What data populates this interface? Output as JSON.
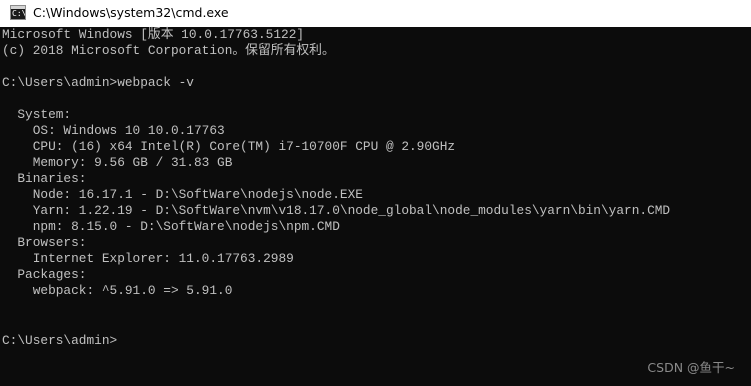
{
  "window": {
    "title": "C:\\Windows\\system32\\cmd.exe",
    "icon": "cmd-icon"
  },
  "console": {
    "lines": [
      "Microsoft Windows [版本 10.0.17763.5122]",
      "(c) 2018 Microsoft Corporation。保留所有权利。",
      "",
      "C:\\Users\\admin>webpack -v",
      "",
      "  System:",
      "    OS: Windows 10 10.0.17763",
      "    CPU: (16) x64 Intel(R) Core(TM) i7-10700F CPU @ 2.90GHz",
      "    Memory: 9.56 GB / 31.83 GB",
      "  Binaries:",
      "    Node: 16.17.1 - D:\\SoftWare\\nodejs\\node.EXE",
      "    Yarn: 1.22.19 - D:\\SoftWare\\nvm\\v18.17.0\\node_global\\node_modules\\yarn\\bin\\yarn.CMD",
      "    npm: 8.15.0 - D:\\SoftWare\\nodejs\\npm.CMD",
      "  Browsers:",
      "    Internet Explorer: 11.0.17763.2989",
      "  Packages:",
      "    webpack: ^5.91.0 => 5.91.0",
      "",
      "",
      "C:\\Users\\admin>"
    ]
  },
  "watermark": "CSDN @鱼干~",
  "colors": {
    "console_bg": "#0c0c0c",
    "console_text": "#c0c0c0",
    "titlebar_bg": "#ffffff"
  }
}
